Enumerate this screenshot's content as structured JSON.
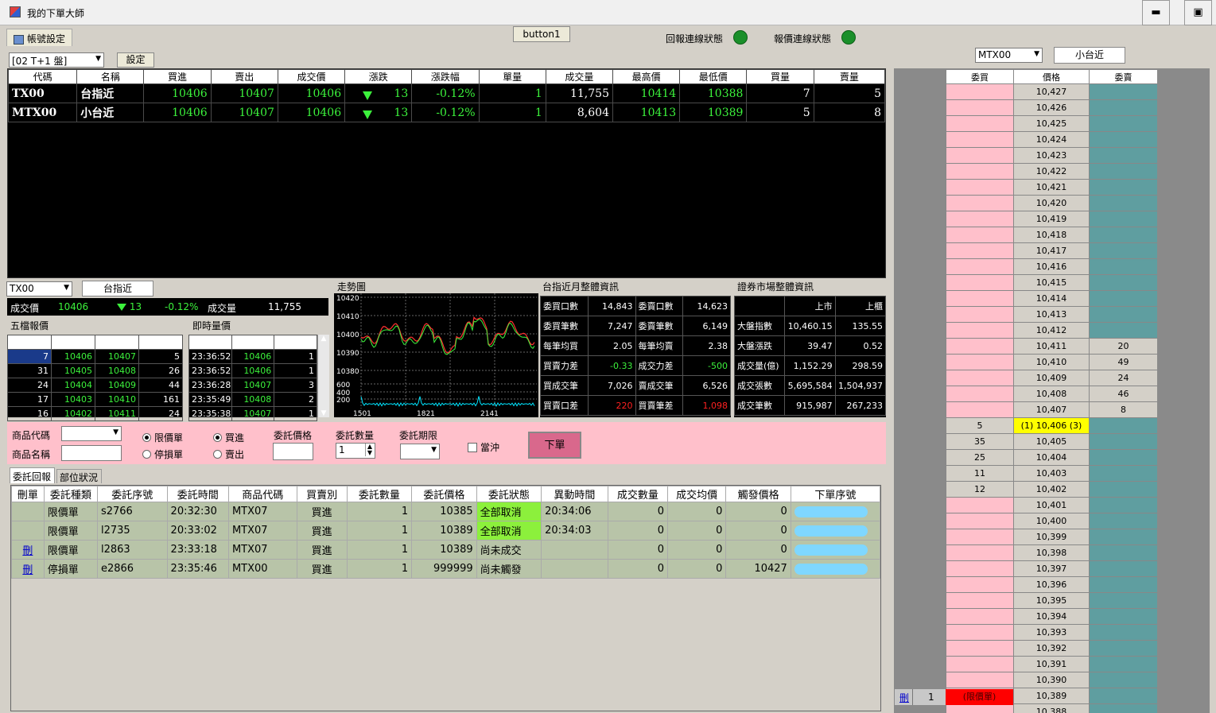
{
  "window": {
    "title": "我的下單大師",
    "minimize": "▬",
    "maximize": "▣"
  },
  "tab_account": "帳號設定",
  "toolbar": {
    "button1": "button1",
    "report_status": "回報連線狀態",
    "quote_status": "報價連線狀態"
  },
  "market_select": "[02 T+1 盤]",
  "set_label": "設定",
  "quote_table": {
    "headers": [
      "代碼",
      "名稱",
      "買進",
      "賣出",
      "成交價",
      "漲跌",
      "漲跌幅",
      "單量",
      "成交量",
      "最高價",
      "最低價",
      "買量",
      "賣量"
    ],
    "rows": [
      {
        "code": "TX00",
        "name": "台指近",
        "bid": "10406",
        "ask": "10407",
        "last": "10406",
        "chg": "13",
        "pct": "-0.12%",
        "unit": "1",
        "vol": "11,755",
        "high": "10414",
        "low": "10388",
        "bidq": "7",
        "askq": "5"
      },
      {
        "code": "MTX00",
        "name": "小台近",
        "bid": "10406",
        "ask": "10407",
        "last": "10406",
        "chg": "13",
        "pct": "-0.12%",
        "unit": "1",
        "vol": "8,604",
        "high": "10413",
        "low": "10389",
        "bidq": "5",
        "askq": "8"
      }
    ]
  },
  "detail": {
    "code": "TX00",
    "name": "台指近",
    "last_label": "成交價",
    "last": "10406",
    "chg": "13",
    "pct": "-0.12%",
    "vol_label": "成交量",
    "vol": "11,755"
  },
  "five": {
    "title": "五檔報價",
    "headers": [
      "委買",
      "買價",
      "賣價",
      "委賣"
    ],
    "rows": [
      [
        "7",
        "10406",
        "10407",
        "5"
      ],
      [
        "31",
        "10405",
        "10408",
        "26"
      ],
      [
        "24",
        "10404",
        "10409",
        "44"
      ],
      [
        "17",
        "10403",
        "10410",
        "161"
      ],
      [
        "16",
        "10402",
        "10411",
        "24"
      ]
    ]
  },
  "ticks": {
    "title": "即時量價",
    "headers": [
      "時間",
      "成交價",
      "單量"
    ],
    "rows": [
      [
        "23:36:52",
        "10406",
        "1"
      ],
      [
        "23:36:52",
        "10406",
        "1"
      ],
      [
        "23:36:28",
        "10407",
        "3"
      ],
      [
        "23:35:49",
        "10408",
        "2"
      ],
      [
        "23:35:38",
        "10407",
        "1"
      ]
    ]
  },
  "trend": {
    "title": "走勢圖",
    "y_ticks": [
      "10420",
      "10410",
      "10400",
      "10390",
      "10380",
      "600",
      "400",
      "200"
    ],
    "x_ticks": [
      "1501",
      "1821",
      "2141"
    ]
  },
  "futures_info": {
    "title": "台指近月整體資訊",
    "rows": [
      [
        "委買口數",
        "14,843",
        "委賣口數",
        "14,623"
      ],
      [
        "委買筆數",
        "7,247",
        "委賣筆數",
        "6,149"
      ],
      [
        "每筆均買",
        "2.05",
        "每筆均賣",
        "2.38"
      ],
      [
        "買賣力差",
        "-0.33",
        "成交力差",
        "-500"
      ],
      [
        "買成交筆",
        "7,026",
        "賣成交筆",
        "6,526"
      ],
      [
        "買賣口差",
        "220",
        "買賣筆差",
        "1,098"
      ]
    ]
  },
  "market_info": {
    "title": "證券市場整體資訊",
    "headers": [
      "",
      "上市",
      "上櫃"
    ],
    "rows": [
      [
        "大盤指數",
        "10,460.15",
        "135.55"
      ],
      [
        "大盤漲跌",
        "39.47",
        "0.52"
      ],
      [
        "成交量(億)",
        "1,152.29",
        "298.59"
      ],
      [
        "成交張數",
        "5,695,584",
        "1,504,937"
      ],
      [
        "成交筆數",
        "915,987",
        "267,233"
      ]
    ]
  },
  "order_form": {
    "product_code": "商品代碼",
    "product_name": "商品名稱",
    "limit": "限價單",
    "stop": "停損單",
    "buy": "買進",
    "sell": "賣出",
    "price_label": "委託價格",
    "qty_label": "委託數量",
    "qty": "1",
    "term_label": "委託期限",
    "daytrade": "當沖",
    "submit": "下單"
  },
  "tabs": {
    "reports": "委託回報",
    "positions": "部位狀況"
  },
  "orders": {
    "headers": [
      "刪單",
      "委託種類",
      "委託序號",
      "委託時間",
      "商品代碼",
      "買賣別",
      "委託數量",
      "委託價格",
      "委託狀態",
      "異動時間",
      "成交數量",
      "成交均價",
      "觸發價格",
      "下單序號"
    ],
    "rows": [
      {
        "del": "",
        "type": "限價單",
        "seq": "s2766",
        "time": "20:32:30",
        "code": "MTX07",
        "side": "買進",
        "qty": "1",
        "price": "10385",
        "status": "全部取消",
        "chg": "20:34:06",
        "fq": "0",
        "fp": "0",
        "trig": "0"
      },
      {
        "del": "",
        "type": "限價單",
        "seq": "l2735",
        "time": "20:33:02",
        "code": "MTX07",
        "side": "買進",
        "qty": "1",
        "price": "10389",
        "status": "全部取消",
        "chg": "20:34:03",
        "fq": "0",
        "fp": "0",
        "trig": "0"
      },
      {
        "del": "刪",
        "type": "限價單",
        "seq": "l2863",
        "time": "23:33:18",
        "code": "MTX07",
        "side": "買進",
        "qty": "1",
        "price": "10389",
        "status": "尚未成交",
        "chg": "",
        "fq": "0",
        "fp": "0",
        "trig": "0"
      },
      {
        "del": "刪",
        "type": "停損單",
        "seq": "e2866",
        "time": "23:35:46",
        "code": "MTX00",
        "side": "買進",
        "qty": "1",
        "price": "999999",
        "status": "尚未觸發",
        "chg": "",
        "fq": "0",
        "fp": "0",
        "trig": "10427"
      }
    ]
  },
  "ladder": {
    "code": "MTX00",
    "name": "小台近",
    "headers": [
      "委買",
      "價格",
      "委賣"
    ],
    "rows": [
      [
        "",
        "10,427",
        ""
      ],
      [
        "",
        "10,426",
        ""
      ],
      [
        "",
        "10,425",
        ""
      ],
      [
        "",
        "10,424",
        ""
      ],
      [
        "",
        "10,423",
        ""
      ],
      [
        "",
        "10,422",
        ""
      ],
      [
        "",
        "10,421",
        ""
      ],
      [
        "",
        "10,420",
        ""
      ],
      [
        "",
        "10,419",
        ""
      ],
      [
        "",
        "10,418",
        ""
      ],
      [
        "",
        "10,417",
        ""
      ],
      [
        "",
        "10,416",
        ""
      ],
      [
        "",
        "10,415",
        ""
      ],
      [
        "",
        "10,414",
        ""
      ],
      [
        "",
        "10,413",
        ""
      ],
      [
        "",
        "10,412",
        ""
      ],
      [
        "",
        "10,411",
        "20"
      ],
      [
        "",
        "10,410",
        "49"
      ],
      [
        "",
        "10,409",
        "24"
      ],
      [
        "",
        "10,408",
        "46"
      ],
      [
        "",
        "10,407",
        "8"
      ],
      [
        "5",
        "(1) 10,406 (3)",
        ""
      ],
      [
        "35",
        "10,405",
        ""
      ],
      [
        "25",
        "10,404",
        ""
      ],
      [
        "11",
        "10,403",
        ""
      ],
      [
        "12",
        "10,402",
        ""
      ],
      [
        "",
        "10,401",
        ""
      ],
      [
        "",
        "10,400",
        ""
      ],
      [
        "",
        "10,399",
        ""
      ],
      [
        "",
        "10,398",
        ""
      ],
      [
        "",
        "10,397",
        ""
      ],
      [
        "",
        "10,396",
        ""
      ],
      [
        "",
        "10,395",
        ""
      ],
      [
        "",
        "10,394",
        ""
      ],
      [
        "",
        "10,393",
        ""
      ],
      [
        "",
        "10,392",
        ""
      ],
      [
        "",
        "10,391",
        ""
      ],
      [
        "",
        "10,390",
        ""
      ],
      [
        "",
        "10,389",
        ""
      ],
      [
        "",
        "10,388",
        ""
      ]
    ],
    "order_row": {
      "del": "刪",
      "qty": "1",
      "tag": "(限價單)"
    }
  },
  "colors": {
    "green_text": "#3cf23c",
    "pink": "#ffc0cb",
    "teal": "#5f9ea0",
    "yellow": "#ffff00",
    "red": "#ff0000"
  }
}
